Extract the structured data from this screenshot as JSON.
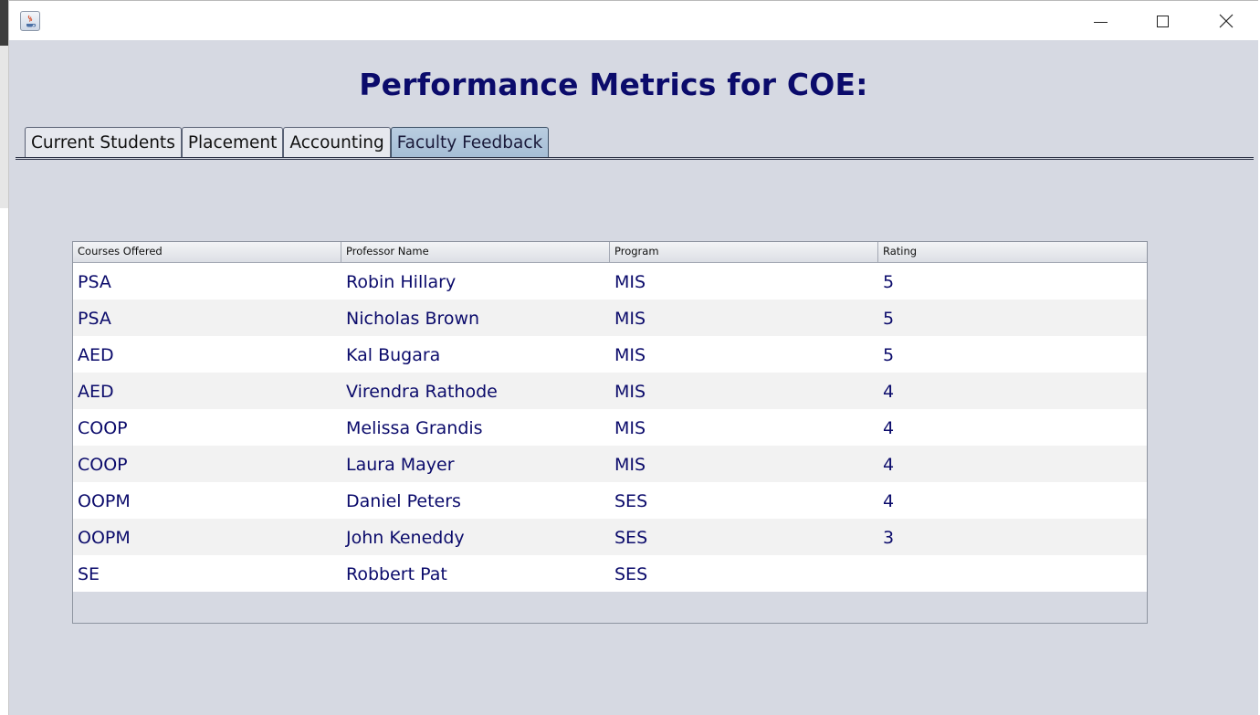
{
  "window": {
    "title": "Performance Metrics for COE:"
  },
  "tabs": [
    {
      "label": "Current Students"
    },
    {
      "label": "Placement"
    },
    {
      "label": "Accounting"
    },
    {
      "label": "Faculty Feedback",
      "active": true
    }
  ],
  "table": {
    "columns": [
      "Courses Offered",
      "Professor Name",
      "Program",
      "Rating"
    ],
    "rows": [
      [
        "PSA",
        "Robin Hillary",
        "MIS",
        "5"
      ],
      [
        "PSA",
        "Nicholas Brown",
        "MIS",
        "5"
      ],
      [
        "AED",
        "Kal Bugara",
        "MIS",
        "5"
      ],
      [
        "AED",
        "Virendra Rathode",
        "MIS",
        "4"
      ],
      [
        "COOP",
        "Melissa Grandis",
        "MIS",
        "4"
      ],
      [
        "COOP",
        "Laura Mayer",
        "MIS",
        "4"
      ],
      [
        "OOPM",
        "Daniel Peters",
        "SES",
        "4"
      ],
      [
        "OOPM",
        "John Keneddy",
        "SES",
        "3"
      ],
      [
        "SE",
        "Robbert Pat",
        "SES",
        ""
      ]
    ]
  },
  "colors": {
    "background": "#d6d9e2",
    "title_text": "#0b0b6b",
    "cell_text": "#0b0b6b",
    "active_tab": "#a6bed6"
  },
  "icons": {
    "app": "java-coffee-icon",
    "minimize": "minimize-icon",
    "maximize": "maximize-icon",
    "close": "close-icon"
  }
}
